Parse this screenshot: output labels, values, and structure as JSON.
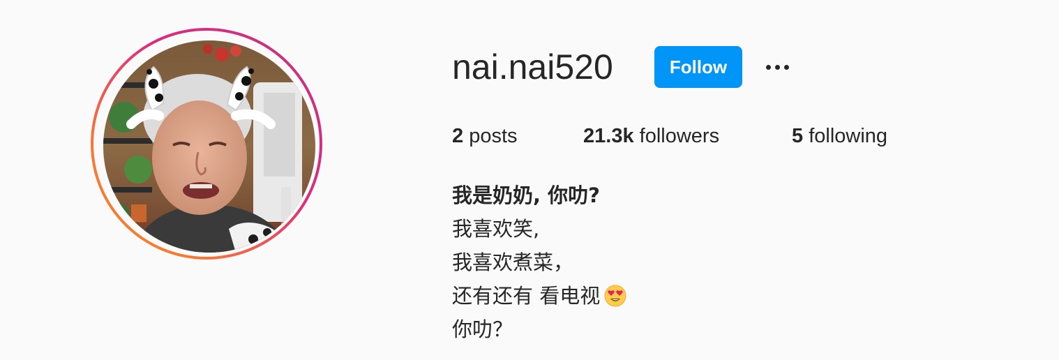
{
  "profile": {
    "username": "nai.nai520",
    "follow_label": "Follow",
    "more_label": "…"
  },
  "stats": {
    "posts_count": "2",
    "posts_label": "posts",
    "followers_count": "21.3k",
    "followers_label": "followers",
    "following_count": "5",
    "following_label": "following"
  },
  "bio": {
    "name": "我是奶奶, 你叻?",
    "lines": [
      "我喜欢笑,",
      "我喜欢煮菜，",
      "还有还有 看电视",
      "你叻？"
    ],
    "emoji": "heart-eyes-emoji"
  },
  "colors": {
    "follow_button": "#0095f6",
    "ring_start": "#f58529",
    "ring_end": "#c13584",
    "text": "#262626",
    "background": "#fafafa"
  }
}
